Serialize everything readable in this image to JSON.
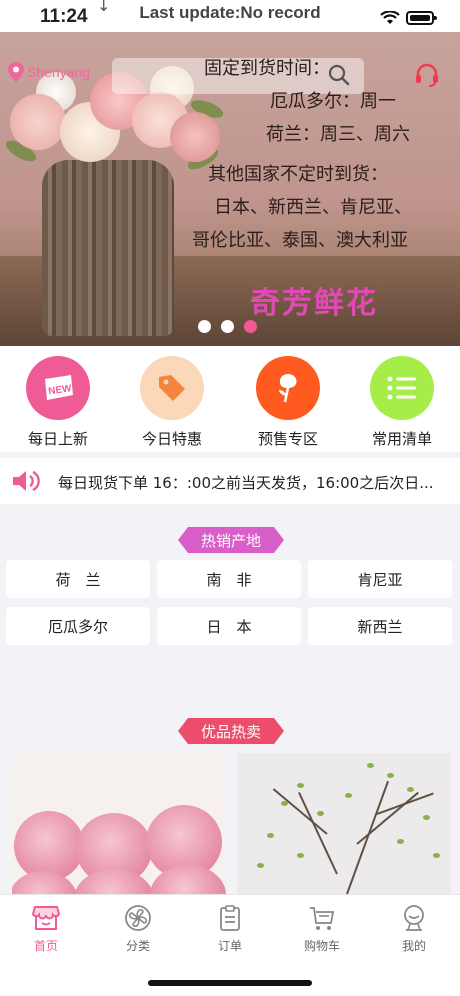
{
  "status_bar": {
    "time": "11:24",
    "update_text": "Last update:No record"
  },
  "header": {
    "location": "Shenyang",
    "icons": [
      "location-pin-icon",
      "search-icon",
      "customer-service-headset-icon"
    ]
  },
  "banner": {
    "lines": [
      "固定到货时间：",
      "厄瓜多尔：周一",
      "荷兰：周三、周六",
      "其他国家不定时到货：",
      "日本、新西兰、肯尼亚、",
      "哥伦比亚、泰国、澳大利亚"
    ],
    "brand": "奇芳鲜花",
    "slide_count": 3,
    "active_slide": 3
  },
  "quick_menu": [
    {
      "label": "每日上新",
      "icon": "new-badge-icon",
      "color": "#ef5c95"
    },
    {
      "label": "今日特惠",
      "icon": "price-tag-icon",
      "color": "#fbd8b8"
    },
    {
      "label": "预售专区",
      "icon": "rose-icon",
      "color": "#ff5a1f"
    },
    {
      "label": "常用清单",
      "icon": "list-icon",
      "color": "#a6ed4a"
    }
  ],
  "notice": {
    "icon": "speaker-icon",
    "text": "每日现货下单 16：:00之前当天发货，16:00之后次日..."
  },
  "hot_origins": {
    "title": "热销产地",
    "items": [
      "荷　兰",
      "南　非",
      "肯尼亚",
      "厄瓜多尔",
      "日　本",
      "新西兰"
    ]
  },
  "best_sellers": {
    "title": "优品热卖"
  },
  "tab_bar": [
    {
      "label": "首页",
      "icon": "shop-icon",
      "active": true
    },
    {
      "label": "分类",
      "icon": "category-icon",
      "active": false
    },
    {
      "label": "订单",
      "icon": "clipboard-icon",
      "active": false
    },
    {
      "label": "购物车",
      "icon": "cart-icon",
      "active": false
    },
    {
      "label": "我的",
      "icon": "profile-icon",
      "active": false
    }
  ],
  "colors": {
    "accent": "#ef5c95",
    "hot_tag": "#d95fc8",
    "best_tag": "#ed4d6a",
    "brand_text": "#e04bb3"
  }
}
